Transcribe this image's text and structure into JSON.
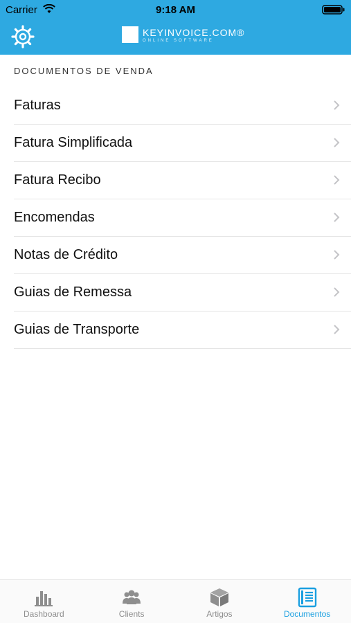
{
  "status": {
    "carrier": "Carrier",
    "time": "9:18 AM"
  },
  "header": {
    "logo_text": "KEYINVOICE.COM®",
    "logo_sub": "ONLINE SOFTWARE"
  },
  "section": {
    "title": "DOCUMENTOS DE VENDA"
  },
  "items": [
    {
      "label": "Faturas"
    },
    {
      "label": "Fatura Simplificada"
    },
    {
      "label": "Fatura Recibo"
    },
    {
      "label": "Encomendas"
    },
    {
      "label": "Notas de Crédito"
    },
    {
      "label": "Guias de Remessa"
    },
    {
      "label": "Guias de Transporte"
    }
  ],
  "tabs": [
    {
      "label": "Dashboard",
      "icon": "bar-chart-icon",
      "active": false
    },
    {
      "label": "Clients",
      "icon": "people-icon",
      "active": false
    },
    {
      "label": "Artigos",
      "icon": "box-icon",
      "active": false
    },
    {
      "label": "Documentos",
      "icon": "document-icon",
      "active": true
    }
  ],
  "colors": {
    "brand": "#2ea9e1",
    "active_tab": "#1a9fe0",
    "inactive_tab": "#8e8e8e"
  }
}
